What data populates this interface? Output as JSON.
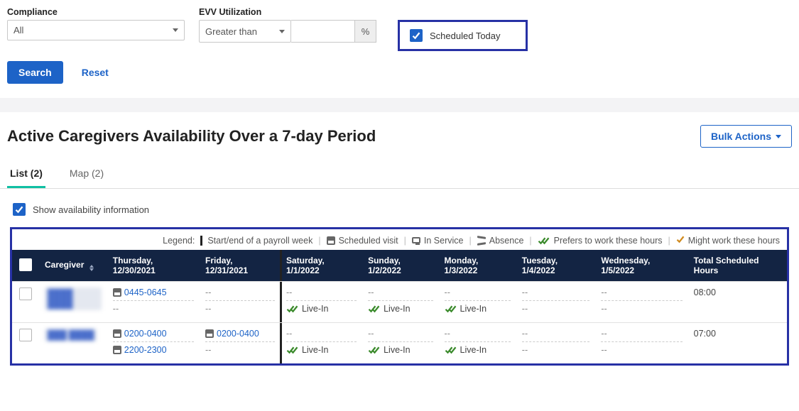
{
  "filters": {
    "compliance_label": "Compliance",
    "compliance_value": "All",
    "evv_label": "EVV Utilization",
    "evv_value": "Greater than",
    "evv_pct_placeholder": "",
    "pct_suffix": "%",
    "scheduled_today": "Scheduled Today"
  },
  "actions": {
    "search": "Search",
    "reset": "Reset"
  },
  "title": "Active Caregivers Availability Over a 7-day Period",
  "bulk_actions": "Bulk Actions",
  "tabs": {
    "list": "List (2)",
    "map": "Map (2)"
  },
  "show_availability": "Show availability information",
  "legend": {
    "label": "Legend:",
    "payroll": "Start/end of a payroll week",
    "scheduled": "Scheduled visit",
    "inservice": "In Service",
    "absence": "Absence",
    "prefers": "Prefers to work these hours",
    "might": "Might work these hours"
  },
  "columns": {
    "caregiver": "Caregiver",
    "d0": "Thursday, 12/30/2021",
    "d1": "Friday, 12/31/2021",
    "d2": "Saturday, 1/1/2022",
    "d3": "Sunday, 1/2/2022",
    "d4": "Monday, 1/3/2022",
    "d5": "Tuesday, 1/4/2022",
    "d6": "Wednesday, 1/5/2022",
    "total": "Total Scheduled Hours"
  },
  "rows": [
    {
      "name_redacted": "████ ████",
      "d0": [
        {
          "type": "visit",
          "text": "0445-0645"
        },
        {
          "type": "dash"
        }
      ],
      "d1": [
        {
          "type": "dash"
        },
        {
          "type": "dash"
        }
      ],
      "d2": [
        {
          "type": "dash"
        },
        {
          "type": "prefers",
          "text": "Live-In"
        }
      ],
      "d3": [
        {
          "type": "dash"
        },
        {
          "type": "prefers",
          "text": "Live-In"
        }
      ],
      "d4": [
        {
          "type": "dash"
        },
        {
          "type": "prefers",
          "text": "Live-In"
        }
      ],
      "d5": [
        {
          "type": "dash"
        },
        {
          "type": "dash"
        }
      ],
      "d6": [
        {
          "type": "dash"
        },
        {
          "type": "dash"
        }
      ],
      "total": "08:00"
    },
    {
      "name_redacted": "███ ████",
      "d0": [
        {
          "type": "visit",
          "text": "0200-0400"
        },
        {
          "type": "visit",
          "text": "2200-2300"
        }
      ],
      "d1": [
        {
          "type": "visit",
          "text": "0200-0400"
        },
        {
          "type": "dash"
        }
      ],
      "d2": [
        {
          "type": "dash"
        },
        {
          "type": "prefers",
          "text": "Live-In"
        }
      ],
      "d3": [
        {
          "type": "dash"
        },
        {
          "type": "prefers",
          "text": "Live-In"
        }
      ],
      "d4": [
        {
          "type": "dash"
        },
        {
          "type": "prefers",
          "text": "Live-In"
        }
      ],
      "d5": [
        {
          "type": "dash"
        },
        {
          "type": "dash"
        }
      ],
      "d6": [
        {
          "type": "dash"
        },
        {
          "type": "dash"
        }
      ],
      "total": "07:00"
    }
  ]
}
